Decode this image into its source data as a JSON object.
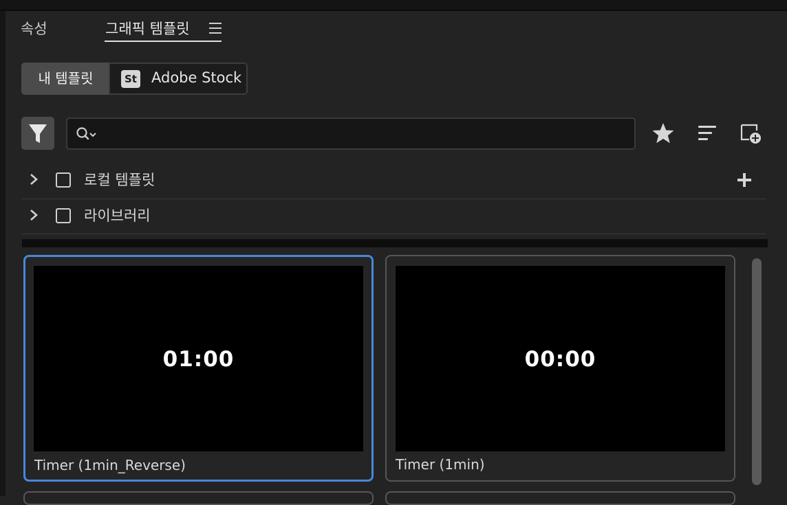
{
  "tabs": {
    "properties": "속성",
    "graphic_templates": "그래픽 템플릿"
  },
  "source_toggle": {
    "my_templates": "내 템플릿",
    "stock_badge": "St",
    "adobe_stock": "Adobe Stock"
  },
  "search": {
    "value": "",
    "placeholder": ""
  },
  "icons": {
    "filter": "filter-icon",
    "search": "search-dropdown-icon",
    "favorite": "star-icon",
    "sort": "sort-lines-icon",
    "new_template": "new-item-plus-icon",
    "add": "plus-icon"
  },
  "tree": [
    {
      "label": "로컬 템플릿"
    },
    {
      "label": "라이브러리"
    }
  ],
  "templates": [
    {
      "time": "01:00",
      "name": "Timer (1min_Reverse)"
    },
    {
      "time": "00:00",
      "name": "Timer (1min)"
    }
  ],
  "colors": {
    "panel_bg": "#232323",
    "selection_accent": "#4a86d9",
    "active_toggle": "#4b4b4b"
  }
}
